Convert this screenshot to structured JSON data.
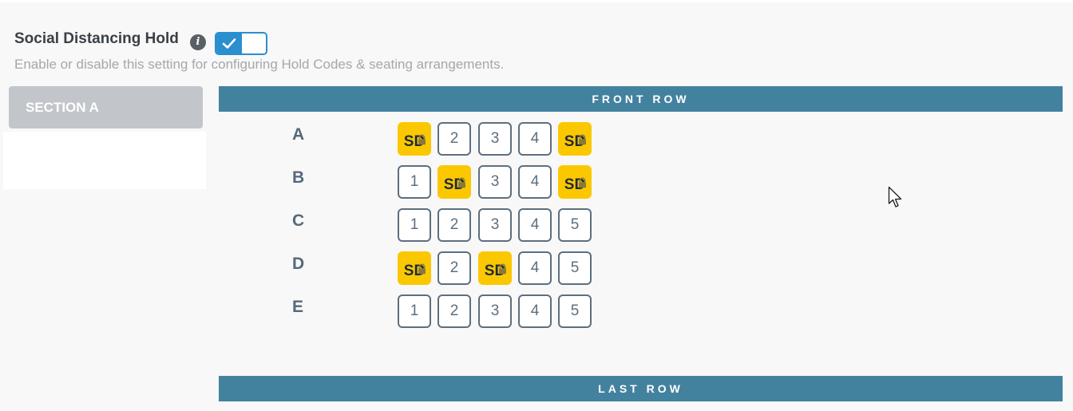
{
  "setting": {
    "title": "Social Distancing Hold",
    "description": "Enable or disable this setting for configuring Hold Codes & seating arrangements.",
    "info_icon": "info-icon",
    "toggle_enabled": true,
    "toggle_color": "#2a8fcf"
  },
  "sections": {
    "active_label": "SECTION A"
  },
  "layout": {
    "front_label": "FRONT ROW",
    "last_label": "LAST ROW",
    "bar_color": "#43829f",
    "hold_color": "#fbc800",
    "rows": [
      {
        "label": "A",
        "seats": [
          {
            "text": "SD",
            "hold": true
          },
          {
            "text": "2",
            "hold": false
          },
          {
            "text": "3",
            "hold": false
          },
          {
            "text": "4",
            "hold": false
          },
          {
            "text": "SD",
            "hold": true
          }
        ]
      },
      {
        "label": "B",
        "seats": [
          {
            "text": "1",
            "hold": false
          },
          {
            "text": "SD",
            "hold": true
          },
          {
            "text": "3",
            "hold": false
          },
          {
            "text": "4",
            "hold": false
          },
          {
            "text": "SD",
            "hold": true
          }
        ]
      },
      {
        "label": "C",
        "seats": [
          {
            "text": "1",
            "hold": false
          },
          {
            "text": "2",
            "hold": false
          },
          {
            "text": "3",
            "hold": false
          },
          {
            "text": "4",
            "hold": false
          },
          {
            "text": "5",
            "hold": false
          }
        ]
      },
      {
        "label": "D",
        "seats": [
          {
            "text": "SD",
            "hold": true
          },
          {
            "text": "2",
            "hold": false
          },
          {
            "text": "SD",
            "hold": true
          },
          {
            "text": "4",
            "hold": false
          },
          {
            "text": "5",
            "hold": false
          }
        ]
      },
      {
        "label": "E",
        "seats": [
          {
            "text": "1",
            "hold": false
          },
          {
            "text": "2",
            "hold": false
          },
          {
            "text": "3",
            "hold": false
          },
          {
            "text": "4",
            "hold": false
          },
          {
            "text": "5",
            "hold": false
          }
        ]
      }
    ]
  }
}
